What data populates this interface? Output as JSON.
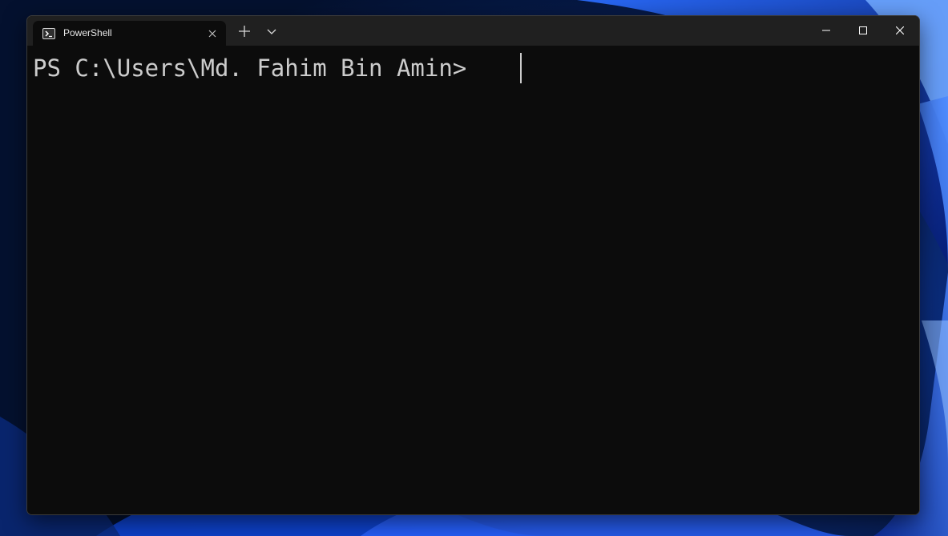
{
  "window": {
    "tab_title": "PowerShell",
    "tab_icon": "powershell-icon",
    "new_tab_icon": "plus-icon",
    "dropdown_icon": "chevron-down-icon",
    "controls": [
      "minimize-icon",
      "maximize-icon",
      "close-icon"
    ]
  },
  "terminal": {
    "prompt": "PS C:\\Users\\Md. Fahim Bin Amin> "
  },
  "colors": {
    "terminal_background": "#0c0c0c",
    "titlebar_background": "#202020",
    "text": "#cccccc",
    "desktop_background": "#071a45",
    "wallpaper_accent": "#1f5cff"
  }
}
